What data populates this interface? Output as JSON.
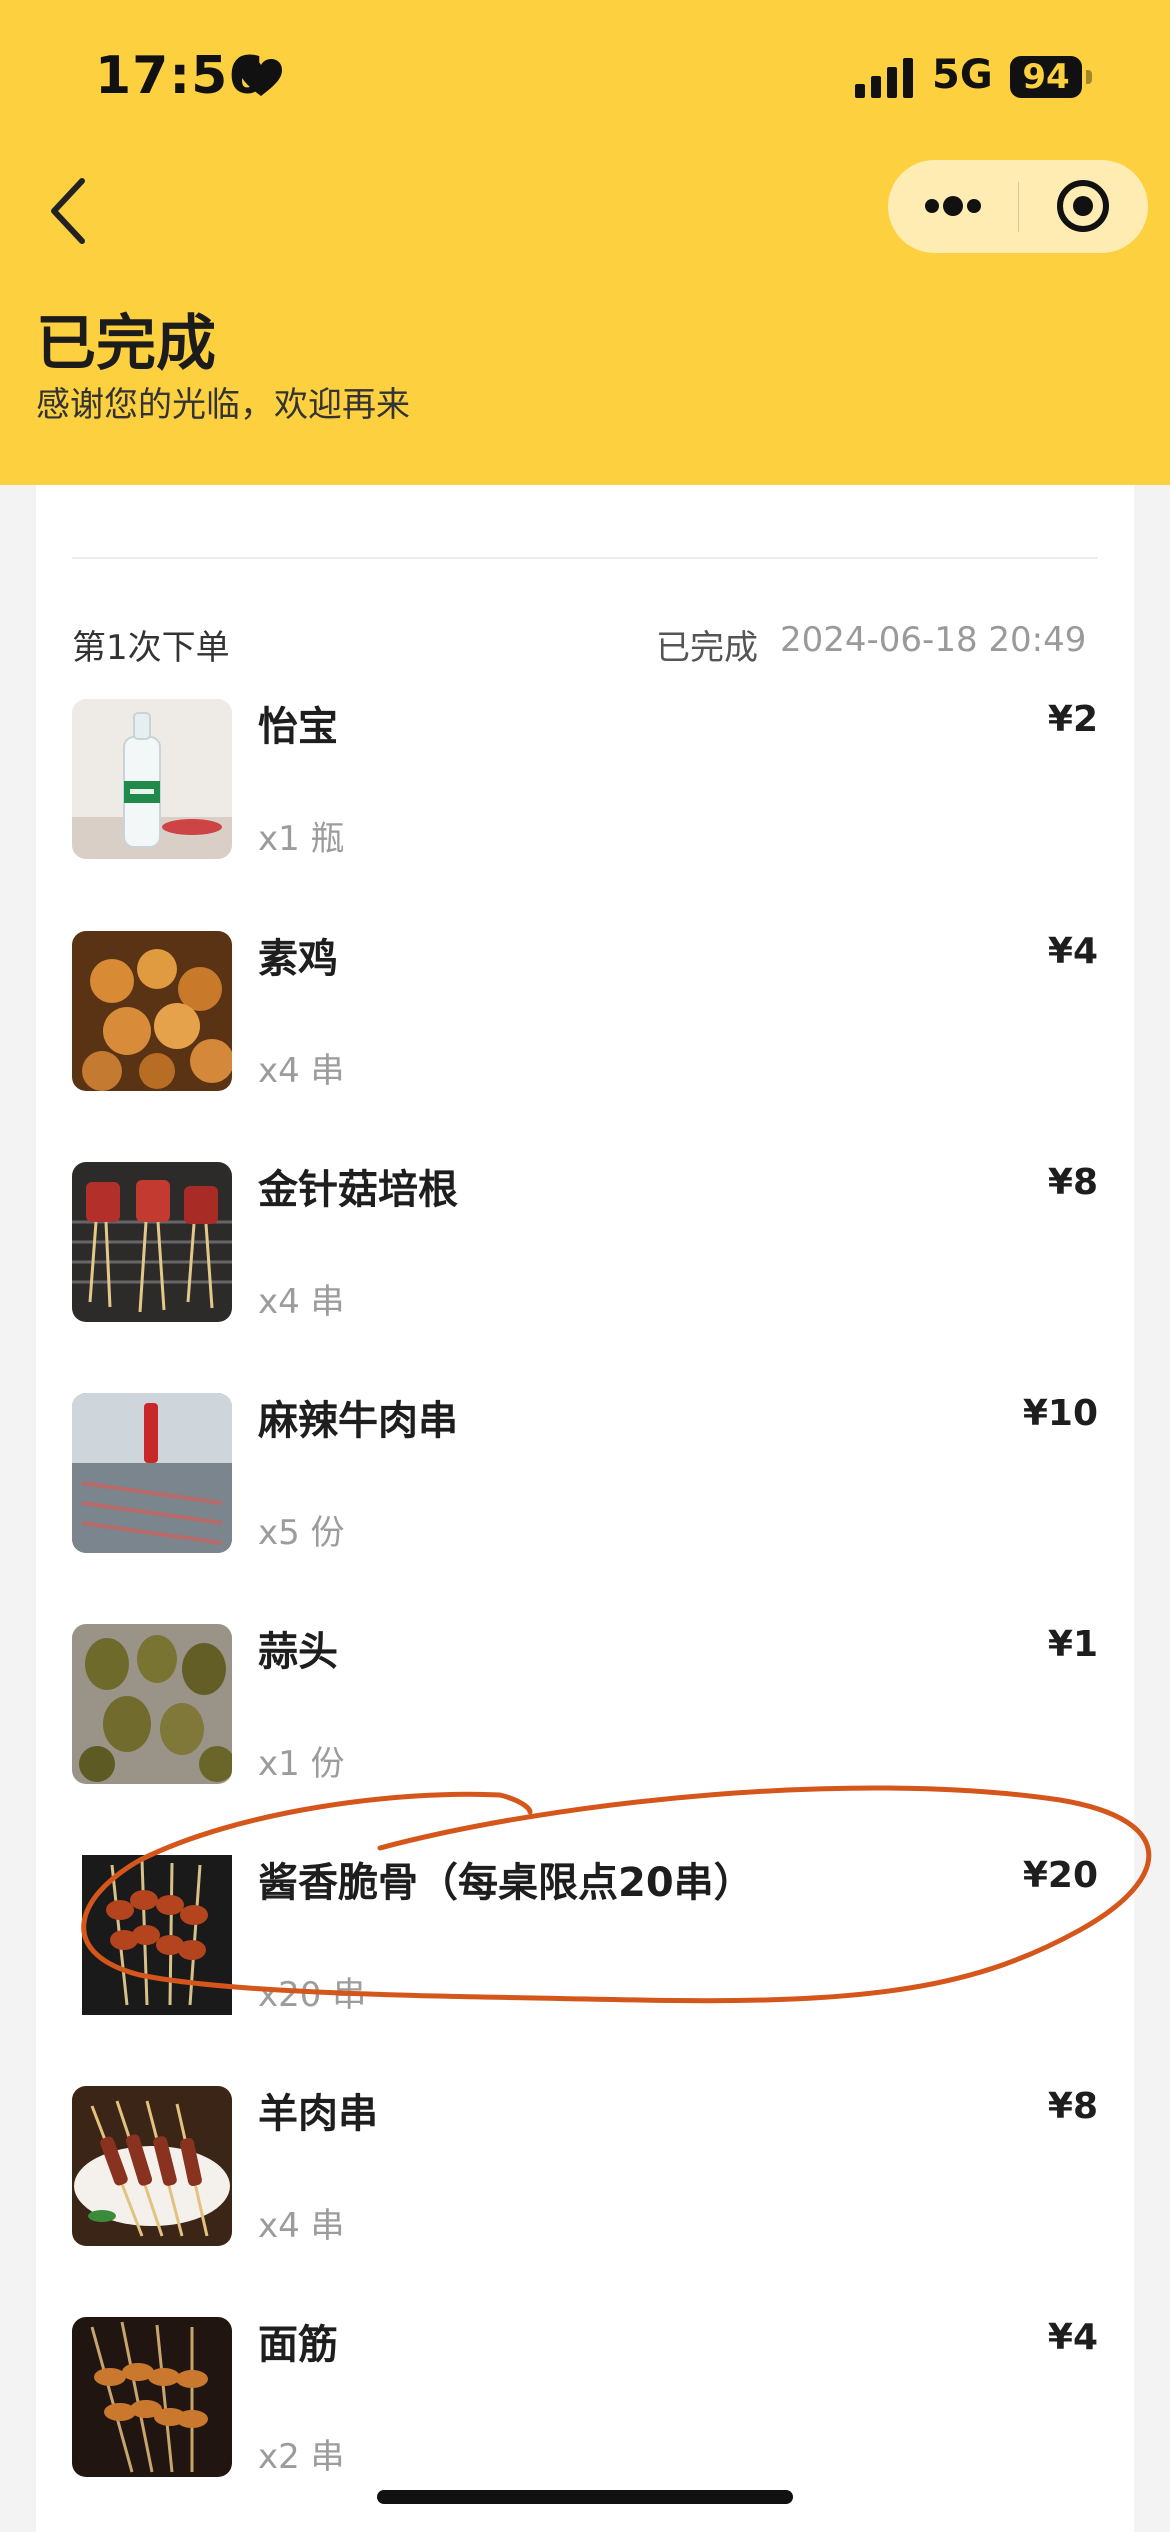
{
  "status_bar": {
    "time": "17:56",
    "network": "5G",
    "battery": "94"
  },
  "nav": {
    "back_icon": "chevron-left-icon",
    "more_icon": "more-dots-icon",
    "close_icon": "target-close-icon"
  },
  "header": {
    "title": "已完成",
    "subtitle": "感谢您的光临，欢迎再来",
    "background_color": "#fdd040"
  },
  "order": {
    "label": "第1次下单",
    "status": "已完成",
    "time": "2024-06-18 20:49",
    "items": [
      {
        "name": "怡宝",
        "qty": "x1 瓶",
        "price": "¥2",
        "image": "bottled-water"
      },
      {
        "name": "素鸡",
        "qty": "x4 串",
        "price": "¥4",
        "image": "grilled-tofu-skewers"
      },
      {
        "name": "金针菇培根",
        "qty": "x4 串",
        "price": "¥8",
        "image": "bacon-enoki-skewers"
      },
      {
        "name": "麻辣牛肉串",
        "qty": "x5 份",
        "price": "¥10",
        "image": "spicy-beef-skewers"
      },
      {
        "name": "蒜头",
        "qty": "x1 份",
        "price": "¥1",
        "image": "grilled-garlic"
      },
      {
        "name": "酱香脆骨（每桌限点20串）",
        "qty": "x20 串",
        "price": "¥20",
        "image": "cartilage-skewers"
      },
      {
        "name": "羊肉串",
        "qty": "x4 串",
        "price": "¥8",
        "image": "lamb-skewers"
      },
      {
        "name": "面筋",
        "qty": "x2 串",
        "price": "¥4",
        "image": "gluten-skewers"
      }
    ]
  },
  "annotation": {
    "color": "#d4561a"
  }
}
